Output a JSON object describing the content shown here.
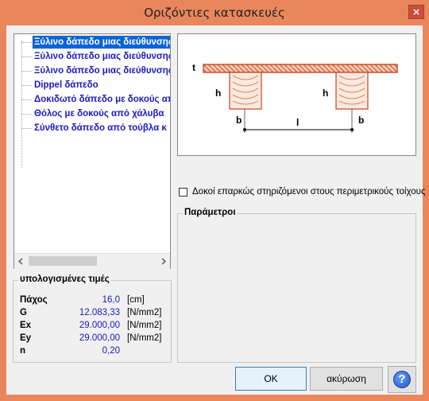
{
  "window": {
    "title": "Οριζόντιες κατασκευές"
  },
  "tree": {
    "items": [
      {
        "label": "Ξύλινο δάπεδο μιας διεύθυνσης",
        "selected": true
      },
      {
        "label": "Ξύλινο δάπεδο μιας διεύθυνσης",
        "selected": false
      },
      {
        "label": "Ξύλινο δάπεδο μιας διεύθυνσης",
        "selected": false
      },
      {
        "label": "Dippel δάπεδο",
        "selected": false
      },
      {
        "label": "Δοκιδωτό δάπεδο με δοκούς από",
        "selected": false
      },
      {
        "label": "Θόλος με δοκούς από χάλυβα",
        "selected": false
      },
      {
        "label": "Σύνθετο δάπεδο από τούβλα κ",
        "selected": false
      }
    ],
    "scroll_position": 0.0
  },
  "calc": {
    "title": "υπολογισμένες τιμές",
    "rows": [
      {
        "label": "Πάχος",
        "value": "16,0",
        "unit": "[cm]"
      },
      {
        "label": "G",
        "value": "12.083,33",
        "unit": "[N/mm2]"
      },
      {
        "label": "Ex",
        "value": "29.000,00",
        "unit": "[N/mm2]"
      },
      {
        "label": "Ey",
        "value": "29.000,00",
        "unit": "[N/mm2]"
      },
      {
        "label": "n",
        "value": "0,20",
        "unit": ""
      }
    ]
  },
  "diagram": {
    "labels": {
      "t": "t",
      "h_left": "h",
      "h_right": "h",
      "b_left": "b",
      "b_right": "b",
      "l": "l"
    }
  },
  "checkbox": {
    "label": "Δοκοί επαρκώς στηριζόμενοι στους περιμετρικούς τοίχους",
    "checked": false
  },
  "params": {
    "title": "Παράμετροι"
  },
  "buttons": {
    "ok": "OK",
    "cancel": "ακύρωση",
    "help": "?"
  },
  "colors": {
    "titlebar": "#e9875c",
    "selection": "#0a64d8",
    "item_text": "#1a1ac0",
    "wood": "#c8451e"
  }
}
